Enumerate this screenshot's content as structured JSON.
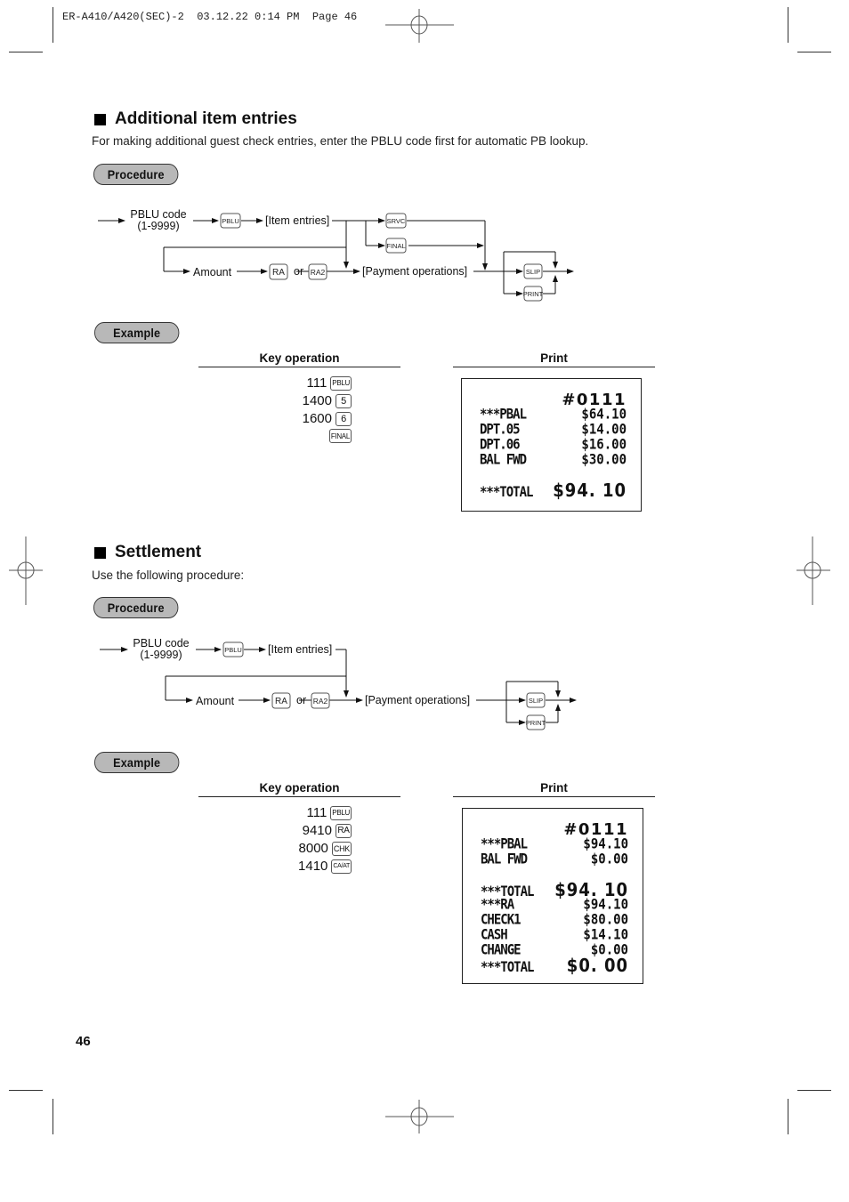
{
  "header": {
    "slug": "ER-A410/A420(SEC)-2  03.12.22 0:14 PM  Page 46"
  },
  "sections": [
    {
      "title": "Additional item entries",
      "description": "For making additional guest check entries, enter the PBLU code first for automatic PB lookup.",
      "procedure_label": "Procedure",
      "flow": {
        "start_label": "PBLU code",
        "start_range": "(1-9999)",
        "pblu_key": "PBLU",
        "item_entries": "[Item entries]",
        "srvc_key": "SRVC",
        "final_key": "FINAL",
        "amount": "Amount",
        "ra_key": "RA",
        "or": "or",
        "ra2_key": "RA2",
        "payment": "[Payment operations]",
        "slip_key": "SLIP",
        "print_key": "PRINT"
      },
      "example_label": "Example",
      "key_operation_header": "Key operation",
      "print_header": "Print",
      "key_ops": [
        {
          "value": "111",
          "key": "PBLU"
        },
        {
          "value": "1400",
          "key": "5"
        },
        {
          "value": "1600",
          "key": "6"
        },
        {
          "value": "",
          "key": "FINAL"
        }
      ],
      "receipt": {
        "header": "#0111",
        "lines": [
          {
            "label": "***PBAL",
            "amount": "$64.10"
          },
          {
            "label": "DPT.05",
            "amount": "$14.00"
          },
          {
            "label": "DPT.06",
            "amount": "$16.00"
          },
          {
            "label": "BAL FWD",
            "amount": "$30.00"
          },
          {
            "label": "***TOTAL",
            "amount": "$94. 10"
          }
        ]
      }
    },
    {
      "title": "Settlement",
      "description": "Use the following procedure:",
      "procedure_label": "Procedure",
      "flow": {
        "start_label": "PBLU code",
        "start_range": "(1-9999)",
        "pblu_key": "PBLU",
        "item_entries": "[Item entries]",
        "amount": "Amount",
        "ra_key": "RA",
        "or": "or",
        "ra2_key": "RA2",
        "payment": "[Payment operations]",
        "slip_key": "SLIP",
        "print_key": "PRINT"
      },
      "example_label": "Example",
      "key_operation_header": "Key operation",
      "print_header": "Print",
      "key_ops": [
        {
          "value": "111",
          "key": "PBLU"
        },
        {
          "value": "9410",
          "key": "RA"
        },
        {
          "value": "8000",
          "key": "CHK"
        },
        {
          "value": "1410",
          "key": "CA/AT"
        }
      ],
      "receipt": {
        "header": "#0111",
        "lines": [
          {
            "label": "***PBAL",
            "amount": "$94.10"
          },
          {
            "label": "BAL FWD",
            "amount": "$0.00"
          },
          {
            "label": "***TOTAL",
            "amount": "$94. 10"
          },
          {
            "label": "***RA",
            "amount": "$94.10"
          },
          {
            "label": "CHECK1",
            "amount": "$80.00"
          },
          {
            "label": "CASH",
            "amount": "$14.10"
          },
          {
            "label": "CHANGE",
            "amount": "$0.00"
          },
          {
            "label": "***TOTAL",
            "amount": "$0. 00"
          }
        ]
      }
    }
  ],
  "footer": {
    "page_number": "46"
  }
}
